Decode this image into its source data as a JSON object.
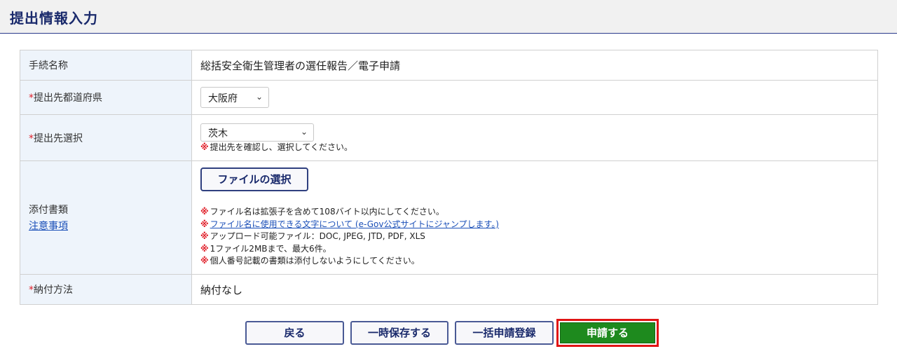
{
  "header": {
    "title": "提出情報入力"
  },
  "form": {
    "procedure": {
      "label": "手続名称",
      "value": "総括安全衛生管理者の選任報告／電子申請"
    },
    "prefecture": {
      "required_mark": "*",
      "label": "提出先都道府県",
      "selected": "大阪府"
    },
    "destination": {
      "required_mark": "*",
      "label": "提出先選択",
      "selected": "茨木",
      "note_mark": "※",
      "note": "提出先を確認し、選択してください。"
    },
    "attachment": {
      "label": "添付書類",
      "caution_link": "注意事項",
      "file_button": "ファイルの選択",
      "notes_mark": "※",
      "note_1": "ファイル名は拡張子を含めて108バイト以内にしてください。",
      "note_2_link": "ファイル名に使用できる文字について (e-Gov公式サイトにジャンプします。)",
      "note_3": "アップロード可能ファイル：DOC, JPEG, JTD, PDF, XLS",
      "note_4": "1ファイル2MBまで、最大6件。",
      "note_5": "個人番号記載の書類は添付しないようにしてください。"
    },
    "payment": {
      "required_mark": "*",
      "label": "納付方法",
      "value": "納付なし"
    }
  },
  "buttons": {
    "back": "戻る",
    "save": "一時保存する",
    "bulk": "一括申請登録",
    "submit": "申請する"
  },
  "colors": {
    "accent_navy": "#1a2a6c",
    "submit_green": "#1e8a1e",
    "required_red": "#e0202a",
    "highlight_red": "#e01515"
  }
}
